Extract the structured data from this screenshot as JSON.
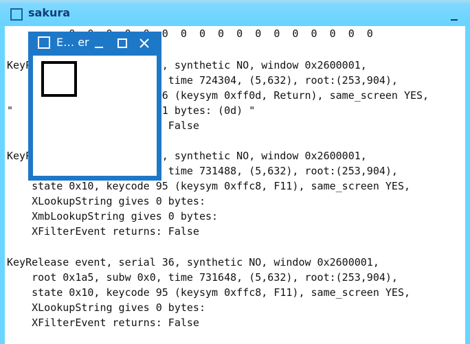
{
  "sakura": {
    "title": "sakura",
    "icon": "window-icon",
    "close_icon": "close-icon",
    "terminal_lines": [
      "          0  0  0  0  0  0  0  0  0  0  0  0  0  0  0  0  0",
      "",
      "KeyPress event, serial 33, synthetic NO, window 0x2600001,",
      "    root 0x1a5, subw 0x0, time 724304, (5,632), root:(253,904),",
      "    state 0x10, keycode 36 (keysym 0xff0d, Return), same_screen YES,",
      "\"    XLookupString gives 1 bytes: (0d) \"",
      "    XFilterEvent returns: False",
      "",
      "KeyPress event, serial 36, synthetic NO, window 0x2600001,",
      "    root 0x1a5, subw 0x0, time 731488, (5,632), root:(253,904),",
      "    state 0x10, keycode 95 (keysym 0xffc8, F11), same_screen YES,",
      "    XLookupString gives 0 bytes:",
      "    XmbLookupString gives 0 bytes:",
      "    XFilterEvent returns: False",
      "",
      "KeyRelease event, serial 36, synthetic NO, window 0x2600001,",
      "    root 0x1a5, subw 0x0, time 731648, (5,632), root:(253,904),",
      "    state 0x10, keycode 95 (keysym 0xffc8, F11), same_screen YES,",
      "    XLookupString gives 0 bytes:",
      "    XFilterEvent returns: False"
    ]
  },
  "event_tester": {
    "title": "E… er",
    "icon": "window-icon",
    "minimize_icon": "minimize-icon",
    "maximize_icon": "maximize-icon",
    "close_icon": "close-icon"
  },
  "colors": {
    "sakura_titlebar": "#66d4ff",
    "sakura_title_text": "#123c7a",
    "event_window_frame": "#1e78c8",
    "terminal_text": "#111111",
    "terminal_bg": "#ffffff"
  }
}
